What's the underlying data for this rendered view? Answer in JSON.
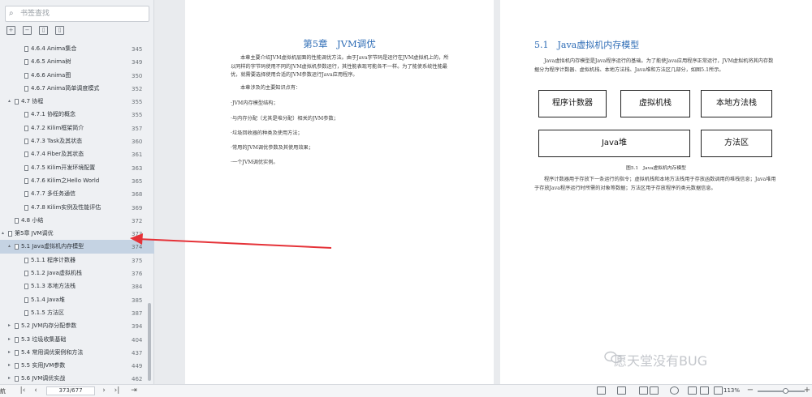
{
  "sidebar": {
    "search_placeholder": "书签查找",
    "toc": [
      {
        "label": "4.6.4 Anima集合",
        "page": "345",
        "level": 3,
        "arrow": ""
      },
      {
        "label": "4.6.5 Anima树",
        "page": "349",
        "level": 3,
        "arrow": ""
      },
      {
        "label": "4.6.6 Anima图",
        "page": "350",
        "level": 3,
        "arrow": ""
      },
      {
        "label": "4.6.7 Anima简单调度模式",
        "page": "352",
        "level": 3,
        "arrow": ""
      },
      {
        "label": "4.7 协程",
        "page": "355",
        "level": 2,
        "arrow": "▴"
      },
      {
        "label": "4.7.1 协程的概念",
        "page": "355",
        "level": 3,
        "arrow": ""
      },
      {
        "label": "4.7.2 Kilim框架简介",
        "page": "357",
        "level": 3,
        "arrow": ""
      },
      {
        "label": "4.7.3 Task及其状态",
        "page": "360",
        "level": 3,
        "arrow": ""
      },
      {
        "label": "4.7.4 Fiber及其状态",
        "page": "361",
        "level": 3,
        "arrow": ""
      },
      {
        "label": "4.7.5 Kilim开发环境配置",
        "page": "363",
        "level": 3,
        "arrow": ""
      },
      {
        "label": "4.7.6 Kilim之Hello World",
        "page": "365",
        "level": 3,
        "arrow": ""
      },
      {
        "label": "4.7.7 多任务通信",
        "page": "368",
        "level": 3,
        "arrow": ""
      },
      {
        "label": "4.7.8 Kilim实例及性能评估",
        "page": "369",
        "level": 3,
        "arrow": ""
      },
      {
        "label": "4.8 小结",
        "page": "372",
        "level": 2,
        "arrow": ""
      },
      {
        "label": "第5章 JVM调优",
        "page": "373",
        "level": 1,
        "arrow": "▴"
      },
      {
        "label": "5.1 Java虚拟机内存模型",
        "page": "374",
        "level": 2,
        "arrow": "▴",
        "selected": true
      },
      {
        "label": "5.1.1 程序计数器",
        "page": "375",
        "level": 3,
        "arrow": ""
      },
      {
        "label": "5.1.2 Java虚拟机栈",
        "page": "376",
        "level": 3,
        "arrow": ""
      },
      {
        "label": "5.1.3 本地方法栈",
        "page": "384",
        "level": 3,
        "arrow": ""
      },
      {
        "label": "5.1.4 Java堆",
        "page": "385",
        "level": 3,
        "arrow": ""
      },
      {
        "label": "5.1.5 方法区",
        "page": "387",
        "level": 3,
        "arrow": ""
      },
      {
        "label": "5.2 JVM内存分配参数",
        "page": "394",
        "level": 2,
        "arrow": "▸"
      },
      {
        "label": "5.3 垃圾收集基础",
        "page": "404",
        "level": 2,
        "arrow": "▸"
      },
      {
        "label": "5.4 常用调优案例和方法",
        "page": "437",
        "level": 2,
        "arrow": "▸"
      },
      {
        "label": "5.5 实用JVM参数",
        "page": "449",
        "level": 2,
        "arrow": "▸"
      },
      {
        "label": "5.6 JVM调优实战",
        "page": "462",
        "level": 2,
        "arrow": "▸"
      }
    ]
  },
  "left_page": {
    "title": "第5章　JVM调优",
    "paragraphs": [
      "本章主要介绍JVM虚拟机层面的性能调优方法。由于Java字节码是运行在JVM虚拟机上的，所以同样的字节码使用不同的JVM虚拟机参数运行，其性能表现可能各不一样。为了能使系统性能最优，就需要选择使用合适的JVM参数运行Java应用程序。",
      "本章涉及的主要知识点有：",
      "·JVM内存模型结构；",
      "·与内存分配（尤其是堆分配）相关的JVM参数；",
      "·垃圾回收器的种类及使用方法；",
      "·常用的JVM调优参数及其使用效果；",
      "·一个JVM调优实例。"
    ]
  },
  "right_page": {
    "section_title": "5.1　Java虚拟机内存模型",
    "intro": "Java虚拟机内存模型是Java程序运行的基础。为了能使Java应用程序正常运行，JVM虚拟机将其内存数据分为程序计数器、虚拟机栈、本地方法栈、Java堆和方法区几部分，如图5.1所示。",
    "diagram_boxes": [
      "程序计数器",
      "虚拟机栈",
      "本地方法栈",
      "Java堆",
      "方法区"
    ],
    "figure_caption": "图5.1　Java虚拟机内存模型",
    "body": "程序计数器用于存放下一条运行的指令；虚拟机栈和本地方法栈用于存放函数调用的堆栈信息；Java堆用于存放Java程序运行时所需的对象等数据；方法区用于存放程序的类元数据信息。"
  },
  "watermark": "愿天堂没有BUG",
  "bottombar": {
    "sidebar_toggle": "航",
    "page_indicator": "373/677",
    "zoom": "113%",
    "zoom_level": 0.6
  }
}
